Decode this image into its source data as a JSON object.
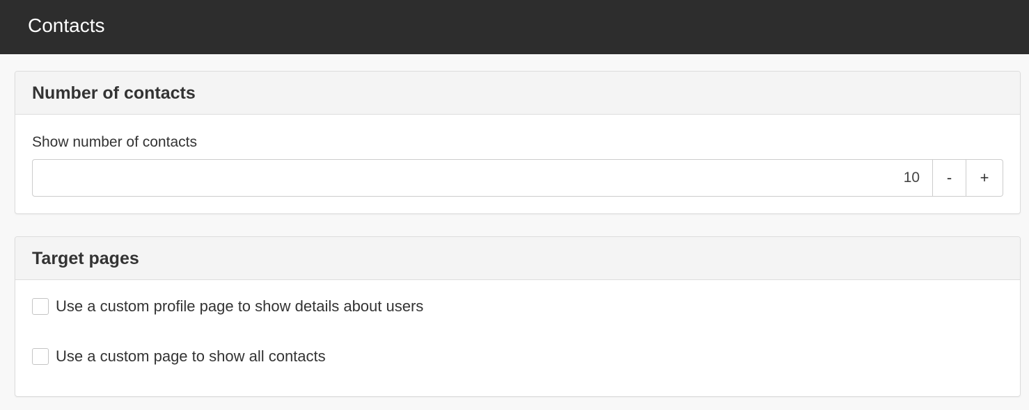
{
  "header": {
    "title": "Contacts"
  },
  "number_panel": {
    "title": "Number of contacts",
    "field_label": "Show number of contacts",
    "value": "10",
    "decrement_label": "-",
    "increment_label": "+"
  },
  "target_panel": {
    "title": "Target pages",
    "options": [
      {
        "label": "Use a custom profile page to show details about users",
        "checked": false
      },
      {
        "label": "Use a custom page to show all contacts",
        "checked": false
      }
    ]
  },
  "colors": {
    "topbar_bg": "#2d2d2d",
    "page_bg": "#f8f8f8",
    "panel_heading_bg": "#f4f4f4",
    "border": "#dddddd"
  }
}
